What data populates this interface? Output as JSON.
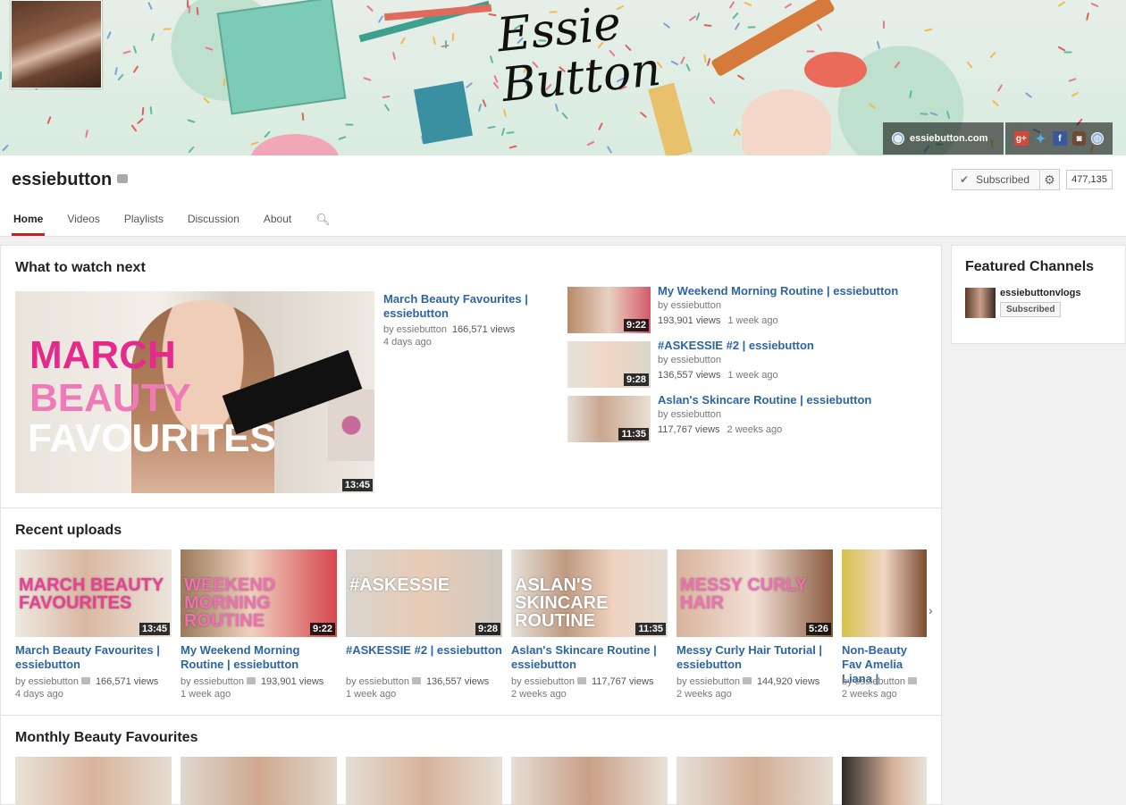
{
  "banner": {
    "logo_text": "Essie Button",
    "site_link": "essiebutton.com",
    "social_icons": [
      "google-plus-icon",
      "twitter-icon",
      "facebook-icon",
      "instagram-icon",
      "globe-icon"
    ]
  },
  "channel": {
    "name": "essiebutton",
    "subscribe_label": "Subscribed",
    "subscriber_count": "477,135",
    "tabs": [
      "Home",
      "Videos",
      "Playlists",
      "Discussion",
      "About"
    ]
  },
  "what_to_watch": {
    "title": "What to watch next",
    "featured": {
      "title": "March Beauty Favourites | essiebutton",
      "by": "by essiebutton",
      "views": "166,571 views",
      "age": "4 days ago",
      "duration": "13:45",
      "overlay": [
        "MARCH",
        "BEAUTY",
        "FAVOURITES"
      ]
    },
    "list": [
      {
        "title": "My Weekend Morning Routine | essiebutton",
        "by": "by essiebutton",
        "views": "193,901 views",
        "age": "1 week ago",
        "duration": "9:22"
      },
      {
        "title": "#ASKESSIE #2 | essiebutton",
        "by": "by essiebutton",
        "views": "136,557 views",
        "age": "1 week ago",
        "duration": "9:28"
      },
      {
        "title": "Aslan's Skincare Routine | essiebutton",
        "by": "by essiebutton",
        "views": "117,767 views",
        "age": "2 weeks ago",
        "duration": "11:35"
      }
    ]
  },
  "recent_uploads": {
    "title": "Recent uploads",
    "items": [
      {
        "title": "March Beauty Favourites | essiebutton",
        "by": "by essiebutton",
        "views": "166,571 views",
        "age": "4 days ago",
        "duration": "13:45",
        "overlay": "MARCH BEAUTY FAVOURITES"
      },
      {
        "title": "My Weekend Morning Routine | essiebutton",
        "by": "by essiebutton",
        "views": "193,901 views",
        "age": "1 week ago",
        "duration": "9:22",
        "overlay": "WEEKEND MORNING ROUTINE"
      },
      {
        "title": "#ASKESSIE #2 | essiebutton",
        "by": "by essiebutton",
        "views": "136,557 views",
        "age": "1 week ago",
        "duration": "9:28",
        "overlay": "#ASKESSIE"
      },
      {
        "title": "Aslan's Skincare Routine | essiebutton",
        "by": "by essiebutton",
        "views": "117,767 views",
        "age": "2 weeks ago",
        "duration": "11:35",
        "overlay": "ASLAN'S SKINCARE ROUTINE"
      },
      {
        "title": "Messy Curly Hair Tutorial | essiebutton",
        "by": "by essiebutton",
        "views": "144,920 views",
        "age": "2 weeks ago",
        "duration": "5:26",
        "overlay": "MESSY CURLY HAIR"
      },
      {
        "title": "Non-Beauty Fav Amelia Liana |",
        "by": "by essiebutton",
        "views": "",
        "age": "2 weeks ago",
        "duration": "",
        "overlay": ""
      }
    ]
  },
  "monthly": {
    "title": "Monthly Beauty Favourites"
  },
  "featured_channels": {
    "title": "Featured Channels",
    "channel_name": "essiebuttonvlogs",
    "subscribe_label": "Subscribed"
  }
}
